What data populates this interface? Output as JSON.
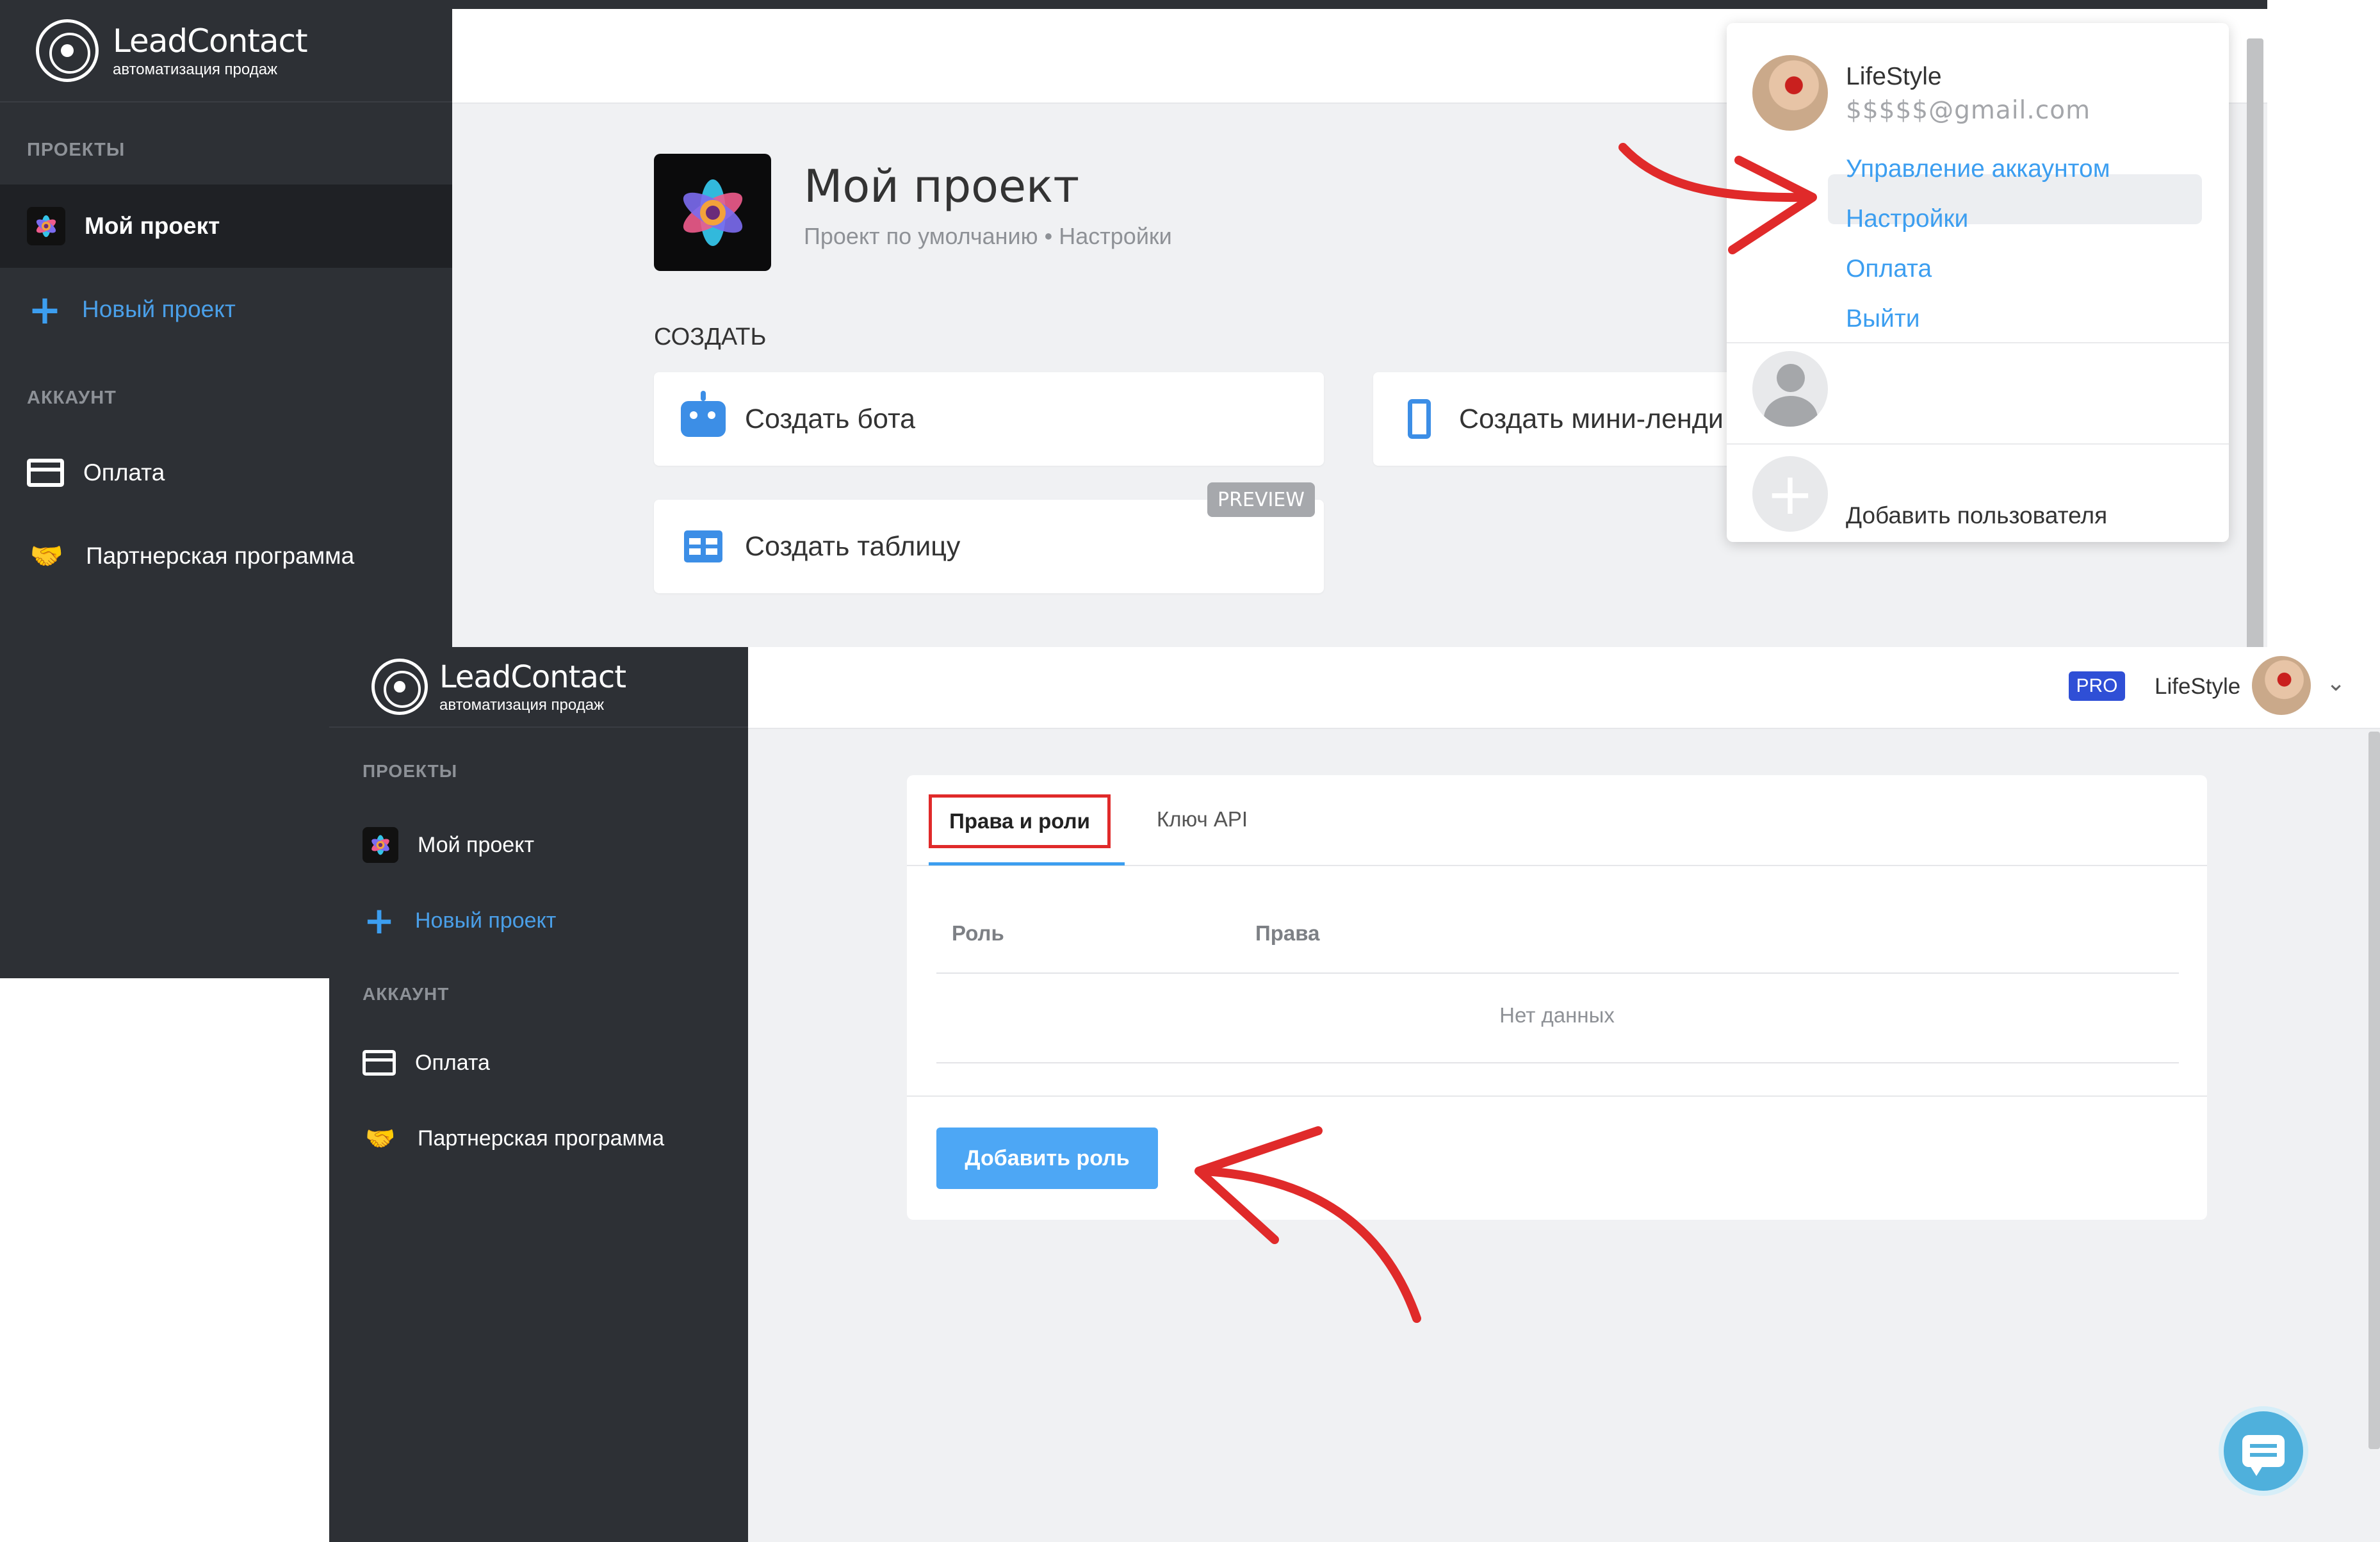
{
  "brand": {
    "name": "LeadContact",
    "tagline": "автоматизация продаж"
  },
  "sidebar": {
    "projects_label": "ПРОЕКТЫ",
    "current_project": "Мой проект",
    "new_project": "Новый проект",
    "account_label": "АККАУНТ",
    "payment": "Оплата",
    "partner_program": "Партнерская программа"
  },
  "project": {
    "title": "Мой проект",
    "breadcrumb": "Проект по умолчанию • Настройки",
    "create_label": "СОЗДАТЬ",
    "cards": {
      "bot": "Создать бота",
      "landing": "Создать мини-ленди",
      "table": "Создать таблицу",
      "preview_badge": "PREVIEW"
    }
  },
  "account_menu": {
    "user_name": "LifeStyle",
    "user_email": "$$$$$@gmail.com",
    "links": {
      "manage": "Управление аккаунтом",
      "settings": "Настройки",
      "billing": "Оплата",
      "logout": "Выйти"
    },
    "add_user": "Добавить пользователя",
    "add_user_icon": "+"
  },
  "header": {
    "plan_badge": "PRO",
    "user_name": "LifeStyle",
    "chevron": "⌄"
  },
  "settings": {
    "tabs": {
      "roles": "Права и роли",
      "api": "Ключ API"
    },
    "table": {
      "col_role": "Роль",
      "col_rights": "Права",
      "empty": "Нет данных"
    },
    "add_role_button": "Добавить роль"
  },
  "icons": {
    "hand": "🤝",
    "plus": "+"
  },
  "colors": {
    "sidebar_bg": "#2d3035",
    "accent_blue": "#3c9ef0",
    "annotation_red": "#e02a2a",
    "pro_badge": "#2f4fd6"
  }
}
